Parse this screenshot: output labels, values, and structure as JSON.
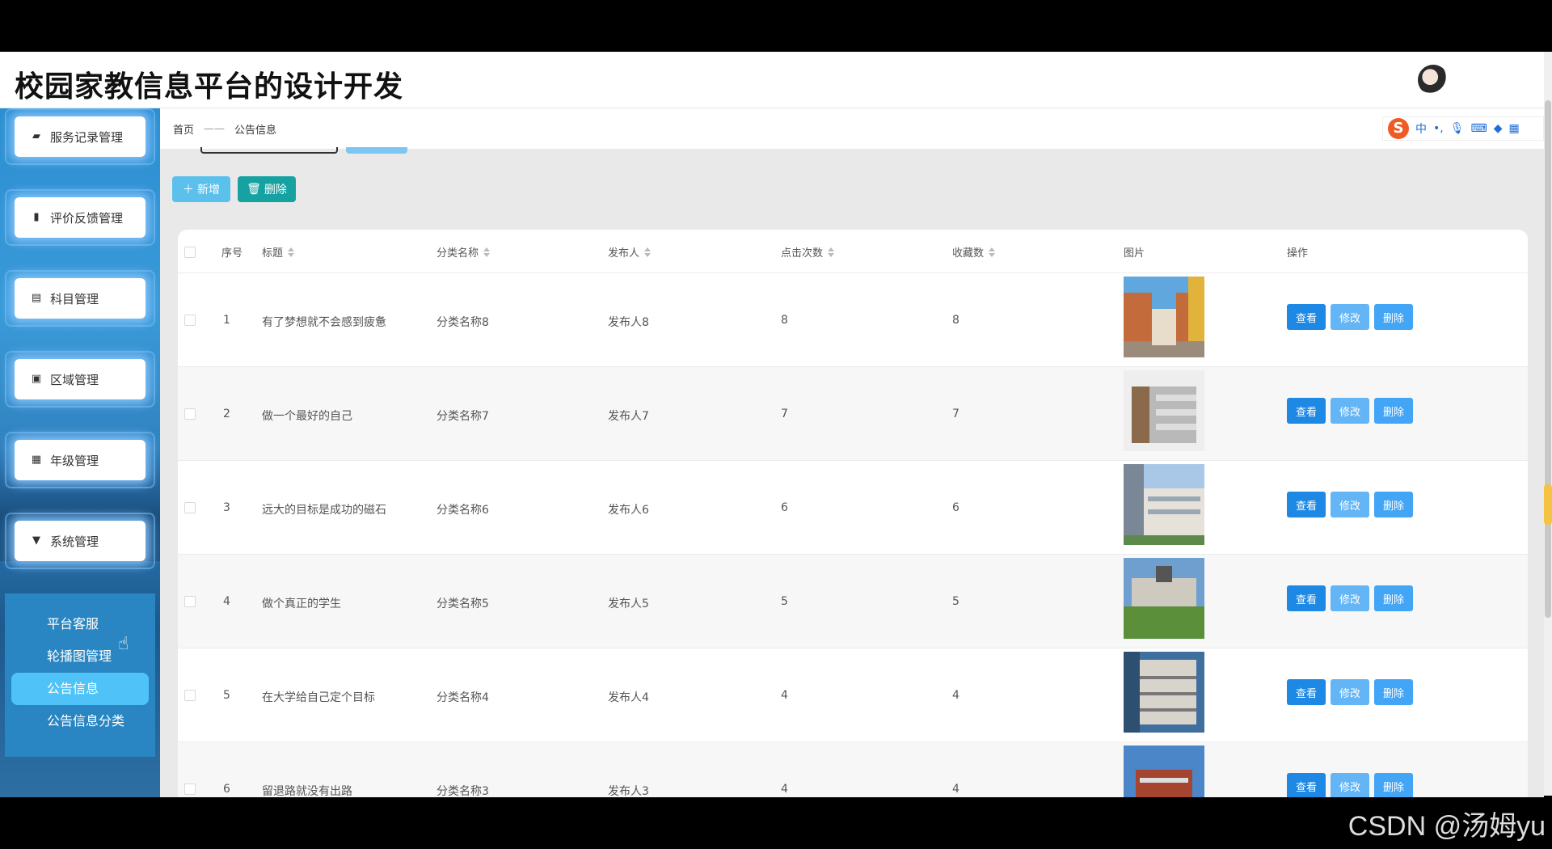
{
  "app": {
    "title": "校园家教信息平台的设计开发"
  },
  "sidebar": {
    "items": [
      {
        "label": "服务记录管理",
        "icon": "briefcase-icon"
      },
      {
        "label": "评价反馈管理",
        "icon": "bar-chart-icon"
      },
      {
        "label": "科目管理",
        "icon": "clipboard-icon"
      },
      {
        "label": "区域管理",
        "icon": "clipboard-check-icon"
      },
      {
        "label": "年级管理",
        "icon": "grid-icon"
      },
      {
        "label": "系统管理",
        "icon": "brush-icon"
      }
    ],
    "submenu": [
      {
        "label": "平台客服"
      },
      {
        "label": "轮播图管理"
      },
      {
        "label": "公告信息",
        "active": true
      },
      {
        "label": "公告信息分类"
      }
    ]
  },
  "breadcrumb": {
    "home": "首页",
    "separator": "——",
    "current": "公告信息"
  },
  "ime": {
    "lang": "中"
  },
  "toolbar": {
    "add_label": "新增",
    "delete_label": "删除"
  },
  "table": {
    "columns": [
      "序号",
      "标题",
      "分类名称",
      "发布人",
      "点击次数",
      "收藏数",
      "图片",
      "操作"
    ],
    "rows": [
      {
        "index": "1",
        "title": "有了梦想就不会感到疲惫",
        "category": "分类名称8",
        "publisher": "发布人8",
        "clicks": "8",
        "favorites": "8"
      },
      {
        "index": "2",
        "title": "做一个最好的自己",
        "category": "分类名称7",
        "publisher": "发布人7",
        "clicks": "7",
        "favorites": "7"
      },
      {
        "index": "3",
        "title": "远大的目标是成功的磁石",
        "category": "分类名称6",
        "publisher": "发布人6",
        "clicks": "6",
        "favorites": "6"
      },
      {
        "index": "4",
        "title": "做个真正的学生",
        "category": "分类名称5",
        "publisher": "发布人5",
        "clicks": "5",
        "favorites": "5"
      },
      {
        "index": "5",
        "title": "在大学给自己定个目标",
        "category": "分类名称4",
        "publisher": "发布人4",
        "clicks": "4",
        "favorites": "4"
      },
      {
        "index": "6",
        "title": "留退路就没有出路",
        "category": "分类名称3",
        "publisher": "发布人3",
        "clicks": "4",
        "favorites": "4"
      }
    ],
    "actions": {
      "view": "查看",
      "edit": "修改",
      "delete": "删除"
    }
  },
  "watermark": "CSDN @汤姆yu",
  "colors": {
    "primary": "#1e88e5",
    "sidebar": "#2c8fd1",
    "active": "#4fc3f7",
    "teal": "#17a2a2"
  }
}
